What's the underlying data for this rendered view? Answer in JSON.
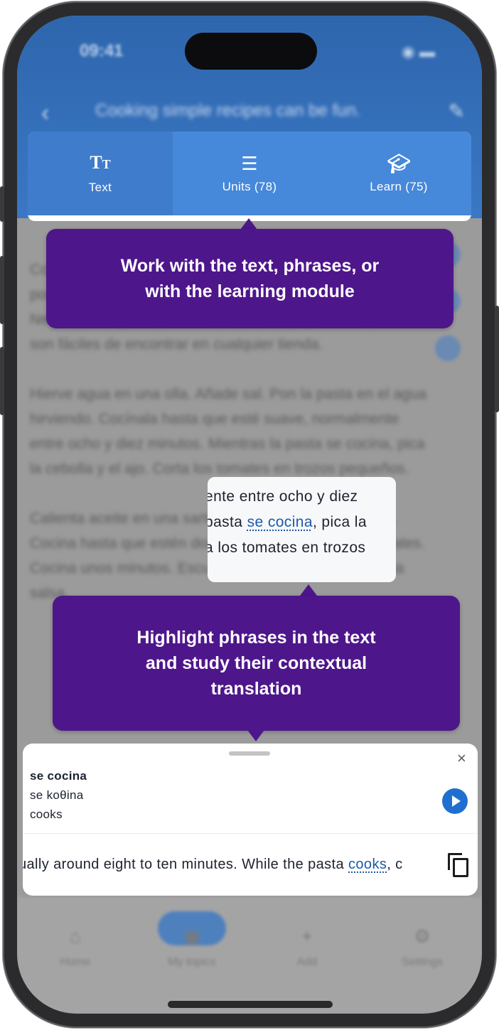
{
  "status_bar": {
    "time": "09:41",
    "icons": "◉ ▬"
  },
  "nav": {
    "back_icon": "‹",
    "title": "Cooking simple recipes can be fun.",
    "edit_icon": "✎"
  },
  "tabs": [
    {
      "label": "Text",
      "icon": "text-size-icon",
      "active": true
    },
    {
      "label": "Units (78)",
      "icon": "list-icon",
      "active": false
    },
    {
      "label": "Learn (75)",
      "icon": "graduation-cap-icon",
      "active": false
    }
  ],
  "tooltips": {
    "tabs_hint": "Work with the text, phrases, or with the learning module",
    "highlight_hint": "Highlight phrases in the text and study their contextual translation"
  },
  "body_text": [
    "Cocinar recetas simples puede ser divertido. Necesitamos pocos ingredientes para hacer una receta rápida. Necesitamos pasta, tomates, cebolla, ajo y aceite. Estos son fáciles de encontrar en cualquier tienda.",
    "Hierve agua en una olla. Añade sal. Pon la pasta en el agua hirviendo. Cocínala hasta que esté suave, normalmente entre ocho y diez minutos. Mientras la pasta se cocina, pica la cebolla y el ajo. Corta los tomates en trozos pequeños.",
    "Calienta aceite en una sartén. Añade la cebolla y el ajo. Cocina hasta que estén dorados. Luego añade los tomates. Cocina unos minutos. Escurre la pasta y mézclala con la salsa."
  ],
  "snippet": {
    "line1": "ente entre ocho y diez",
    "line2_before": "pasta ",
    "line2_phrase": "se cocina",
    "line2_after": ", pica la",
    "line3": "a los tomates en trozos"
  },
  "sheet": {
    "phrase": "se cocina",
    "phonetic": "se koθina",
    "translation": "cooks",
    "context_before": "ually around eight to ten minutes. While the pasta ",
    "context_phrase": "cooks",
    "context_after": ", c",
    "close_icon": "×"
  },
  "bottom_nav": [
    {
      "label": "Home",
      "icon": "⌂"
    },
    {
      "label": "My topics",
      "icon": "▣"
    },
    {
      "label": "Add",
      "icon": "+"
    },
    {
      "label": "Settings",
      "icon": "⚙"
    }
  ],
  "colors": {
    "primary": "#3a77c4",
    "tab_bar": "#4688d9",
    "tooltip": "#4e168b",
    "link": "#1e5aa8",
    "play_button": "#1f6fd0"
  }
}
